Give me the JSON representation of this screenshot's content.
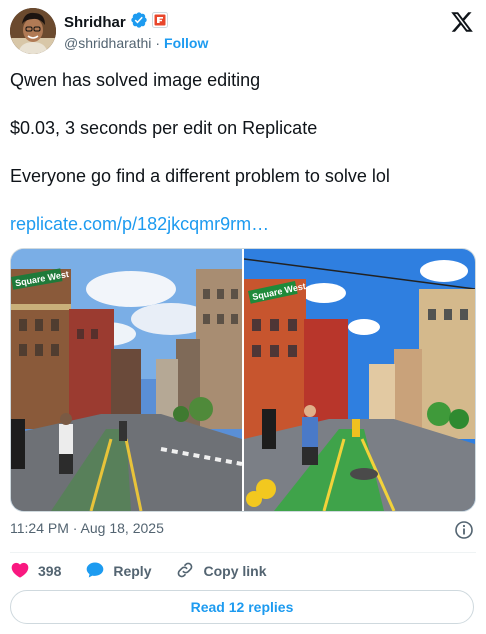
{
  "author": {
    "display_name": "Shridhar",
    "handle": "@shridharathi",
    "separator": "·",
    "follow_label": "Follow"
  },
  "tweet": {
    "lines": [
      "Qwen has solved image editing",
      "$0.03, 3 seconds per edit on Replicate",
      "Everyone go find a different problem to solve lol"
    ],
    "link": "replicate.com/p/182jkcqmr9rm…"
  },
  "media": {
    "left_sign": "Square West",
    "right_sign": "Square West"
  },
  "meta": {
    "timestamp": "11:24 PM · Aug 18, 2025"
  },
  "actions": {
    "like_count": "398",
    "reply_label": "Reply",
    "copy_link_label": "Copy link"
  },
  "replies_button": "Read 12 replies",
  "colors": {
    "accent": "#1d9bf0",
    "like": "#f91880",
    "text": "#0f1419",
    "muted": "#536471"
  },
  "icons": {
    "verified": "verified-badge-icon",
    "affiliate": "affiliate-badge-icon",
    "brand": "x-logo-icon",
    "info": "info-icon",
    "like": "heart-icon",
    "reply": "speech-bubble-icon",
    "copy": "link-icon"
  }
}
